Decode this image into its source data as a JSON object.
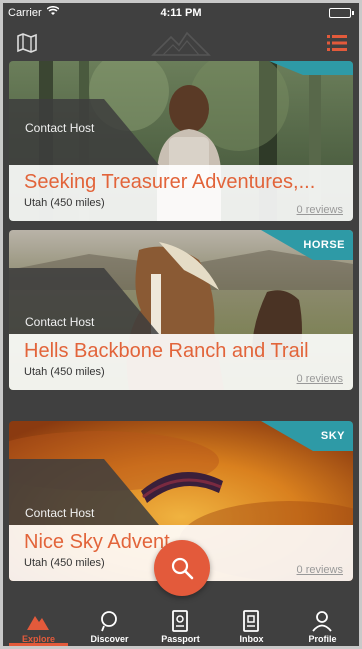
{
  "status_bar": {
    "carrier": "Carrier",
    "time": "4:11 PM"
  },
  "cards": [
    {
      "host_label": "Contact Host",
      "title": "Seeking Treasurer Adventures,...",
      "location": "Utah (450 miles)",
      "reviews": "0 reviews",
      "tag": ""
    },
    {
      "host_label": "Contact Host",
      "title": "Hells Backbone Ranch and Trail",
      "location": "Utah (450 miles)",
      "reviews": "0 reviews",
      "tag": "HORSE"
    },
    {
      "host_label": "Contact Host",
      "title": "Nice Sky Advent",
      "location": "Utah (450 miles)",
      "reviews": "0 reviews",
      "tag": "SKY"
    }
  ],
  "tabs": [
    {
      "label": "Explore",
      "icon": "mountain-icon",
      "active": true
    },
    {
      "label": "Discover",
      "icon": "compass-icon",
      "active": false
    },
    {
      "label": "Passport",
      "icon": "passport-icon",
      "active": false
    },
    {
      "label": "Inbox",
      "icon": "inbox-icon",
      "active": false
    },
    {
      "label": "Profile",
      "icon": "profile-icon",
      "active": false
    }
  ],
  "colors": {
    "accent": "#e35a3b",
    "tag_teal": "#2e9aa6",
    "bar_dark": "#404040"
  }
}
